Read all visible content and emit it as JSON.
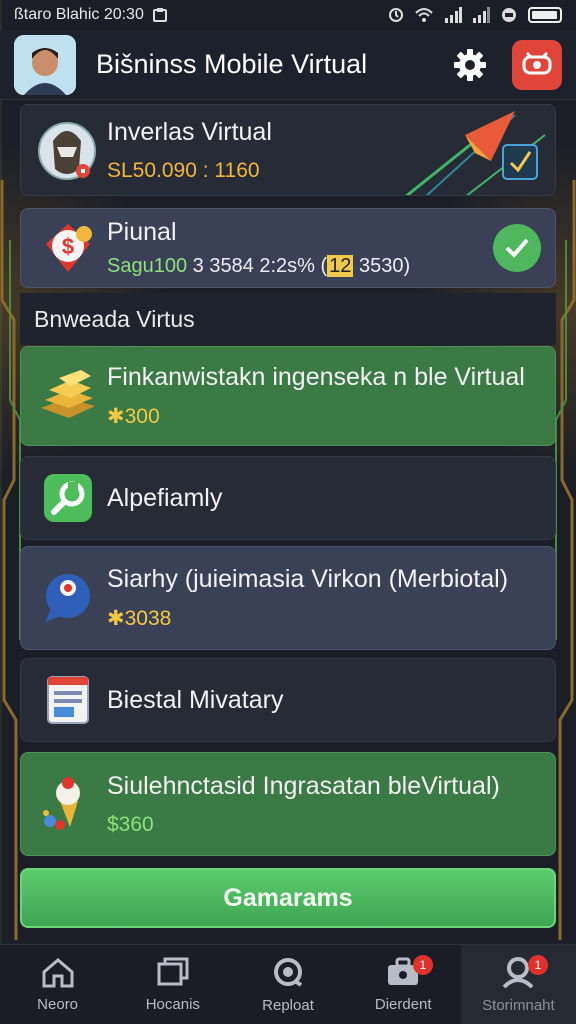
{
  "status_bar": {
    "left_text": "ßtaro Blahic 20:30",
    "signal": "signal-icon",
    "wifi": "wifi-icon",
    "battery": "battery-icon"
  },
  "header": {
    "title": "Bišninss Mobile Virtual",
    "settings_icon": "gear-icon",
    "action_icon": "game-icon",
    "accent": "#e0453a"
  },
  "cards": {
    "card1": {
      "title": "Inverlas Virtual",
      "subtitle": "SL50.090 : 1160"
    },
    "card2": {
      "title": "Piunal",
      "sub_green": "Sagu100",
      "sub_white": " 3 3584 2:2s% (",
      "sub_highlight": "12",
      "sub_end": " 3530)"
    },
    "section_label": "Bnweada Virtus",
    "card3": {
      "title": "Finkanwistakn ingenseka n ble Virtual",
      "value": "300"
    },
    "card4": {
      "title": "Alpefiamly"
    },
    "card5": {
      "title": "Siarhy (juieimasia Virkon (Merbiotal)",
      "value": "3038"
    },
    "card6": {
      "title": "Biestal Mivatary"
    },
    "card7": {
      "title": "Siulehnctasid Ingrasatan bleVirtual)",
      "value": "$360"
    }
  },
  "cta": {
    "label": "Gamarams"
  },
  "nav": [
    {
      "label": "Neoro",
      "icon": "home-icon",
      "badge": ""
    },
    {
      "label": "Hocanis",
      "icon": "windows-icon",
      "badge": ""
    },
    {
      "label": "Reploat",
      "icon": "search-icon",
      "badge": ""
    },
    {
      "label": "Dierdent",
      "icon": "briefcase-icon",
      "badge": "1"
    },
    {
      "label": "Storimnaht",
      "icon": "profile-icon",
      "badge": "1"
    }
  ],
  "colors": {
    "background": "#1b1e27",
    "green_card": "#3b7a45",
    "slate_card": "#3a4156",
    "cta_green": "#4fb862"
  }
}
